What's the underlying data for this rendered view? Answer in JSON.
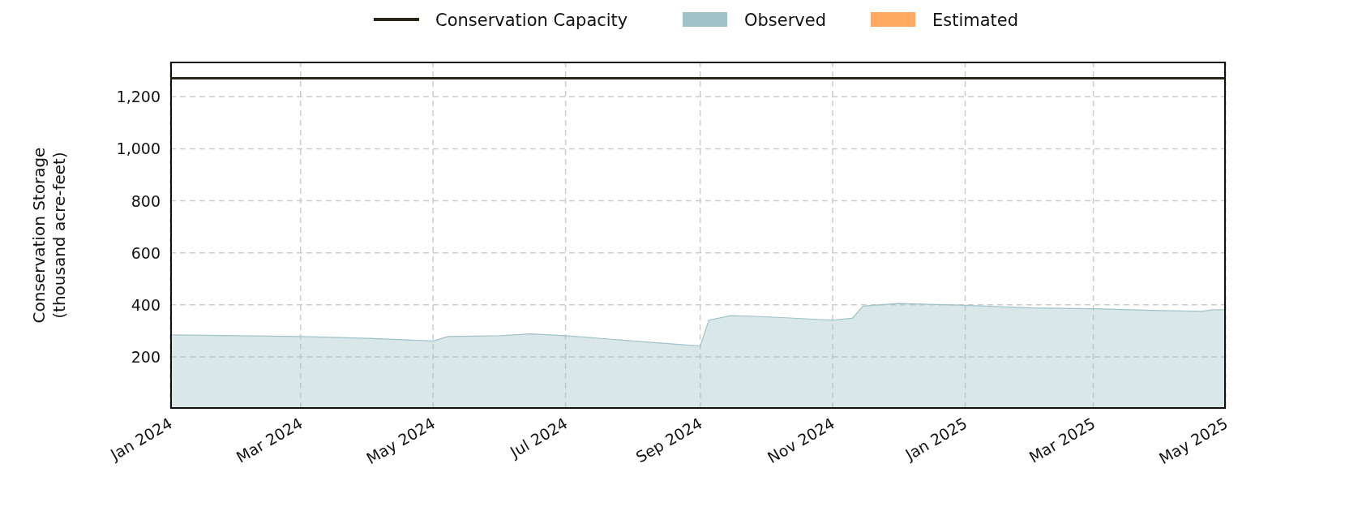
{
  "chart_data": {
    "type": "area",
    "grid": true,
    "legend": "top",
    "ylabel": "Conservation Storage\n(thousand acre-feet)",
    "x": [
      "2024-01-01",
      "2024-02-01",
      "2024-03-01",
      "2024-04-01",
      "2024-05-01",
      "2024-05-08",
      "2024-06-01",
      "2024-06-15",
      "2024-07-01",
      "2024-08-01",
      "2024-09-01",
      "2024-09-05",
      "2024-09-15",
      "2024-10-01",
      "2024-11-01",
      "2024-11-10",
      "2024-11-15",
      "2024-12-01",
      "2025-01-01",
      "2025-02-01",
      "2025-03-01",
      "2025-04-01",
      "2025-04-20",
      "2025-04-25",
      "2025-05-01"
    ],
    "series": [
      {
        "name": "Conservation Capacity",
        "type": "line",
        "color": "#2b2618",
        "values": [
          1271,
          1271,
          1271,
          1271,
          1271,
          1271,
          1271,
          1271,
          1271,
          1271,
          1271,
          1271,
          1271,
          1271,
          1271,
          1271,
          1271,
          1271,
          1271,
          1271,
          1271,
          1271,
          1271,
          1271,
          1271
        ]
      },
      {
        "name": "Observed",
        "color": "#9fc3c9",
        "values": [
          284,
          281,
          278,
          271,
          261,
          278,
          281,
          288,
          281,
          261,
          241,
          341,
          358,
          354,
          341,
          348,
          395,
          405,
          398,
          388,
          385,
          378,
          375,
          381,
          381
        ]
      },
      {
        "name": "Estimated",
        "color": "#ffa862",
        "values": [
          null,
          null,
          null,
          null,
          null,
          null,
          null,
          null,
          null,
          null,
          null,
          null,
          null,
          null,
          null,
          null,
          null,
          null,
          null,
          null,
          null,
          null,
          null,
          null,
          null
        ]
      }
    ],
    "xlim": [
      "2024-01-01",
      "2025-05-01"
    ],
    "ylim": [
      0,
      1335
    ],
    "xticks": [
      {
        "value": "2024-01-01",
        "label": "Jan 2024"
      },
      {
        "value": "2024-03-01",
        "label": "Mar 2024"
      },
      {
        "value": "2024-05-01",
        "label": "May 2024"
      },
      {
        "value": "2024-07-01",
        "label": "Jul 2024"
      },
      {
        "value": "2024-09-01",
        "label": "Sep 2024"
      },
      {
        "value": "2024-11-01",
        "label": "Nov 2024"
      },
      {
        "value": "2025-01-01",
        "label": "Jan 2025"
      },
      {
        "value": "2025-03-01",
        "label": "Mar 2025"
      },
      {
        "value": "2025-05-01",
        "label": "May 2025"
      }
    ],
    "yticks": [
      {
        "value": 200,
        "label": "200"
      },
      {
        "value": 400,
        "label": "400"
      },
      {
        "value": 600,
        "label": "600"
      },
      {
        "value": 800,
        "label": "800"
      },
      {
        "value": 1000,
        "label": "1,000"
      },
      {
        "value": 1200,
        "label": "1,200"
      }
    ]
  }
}
